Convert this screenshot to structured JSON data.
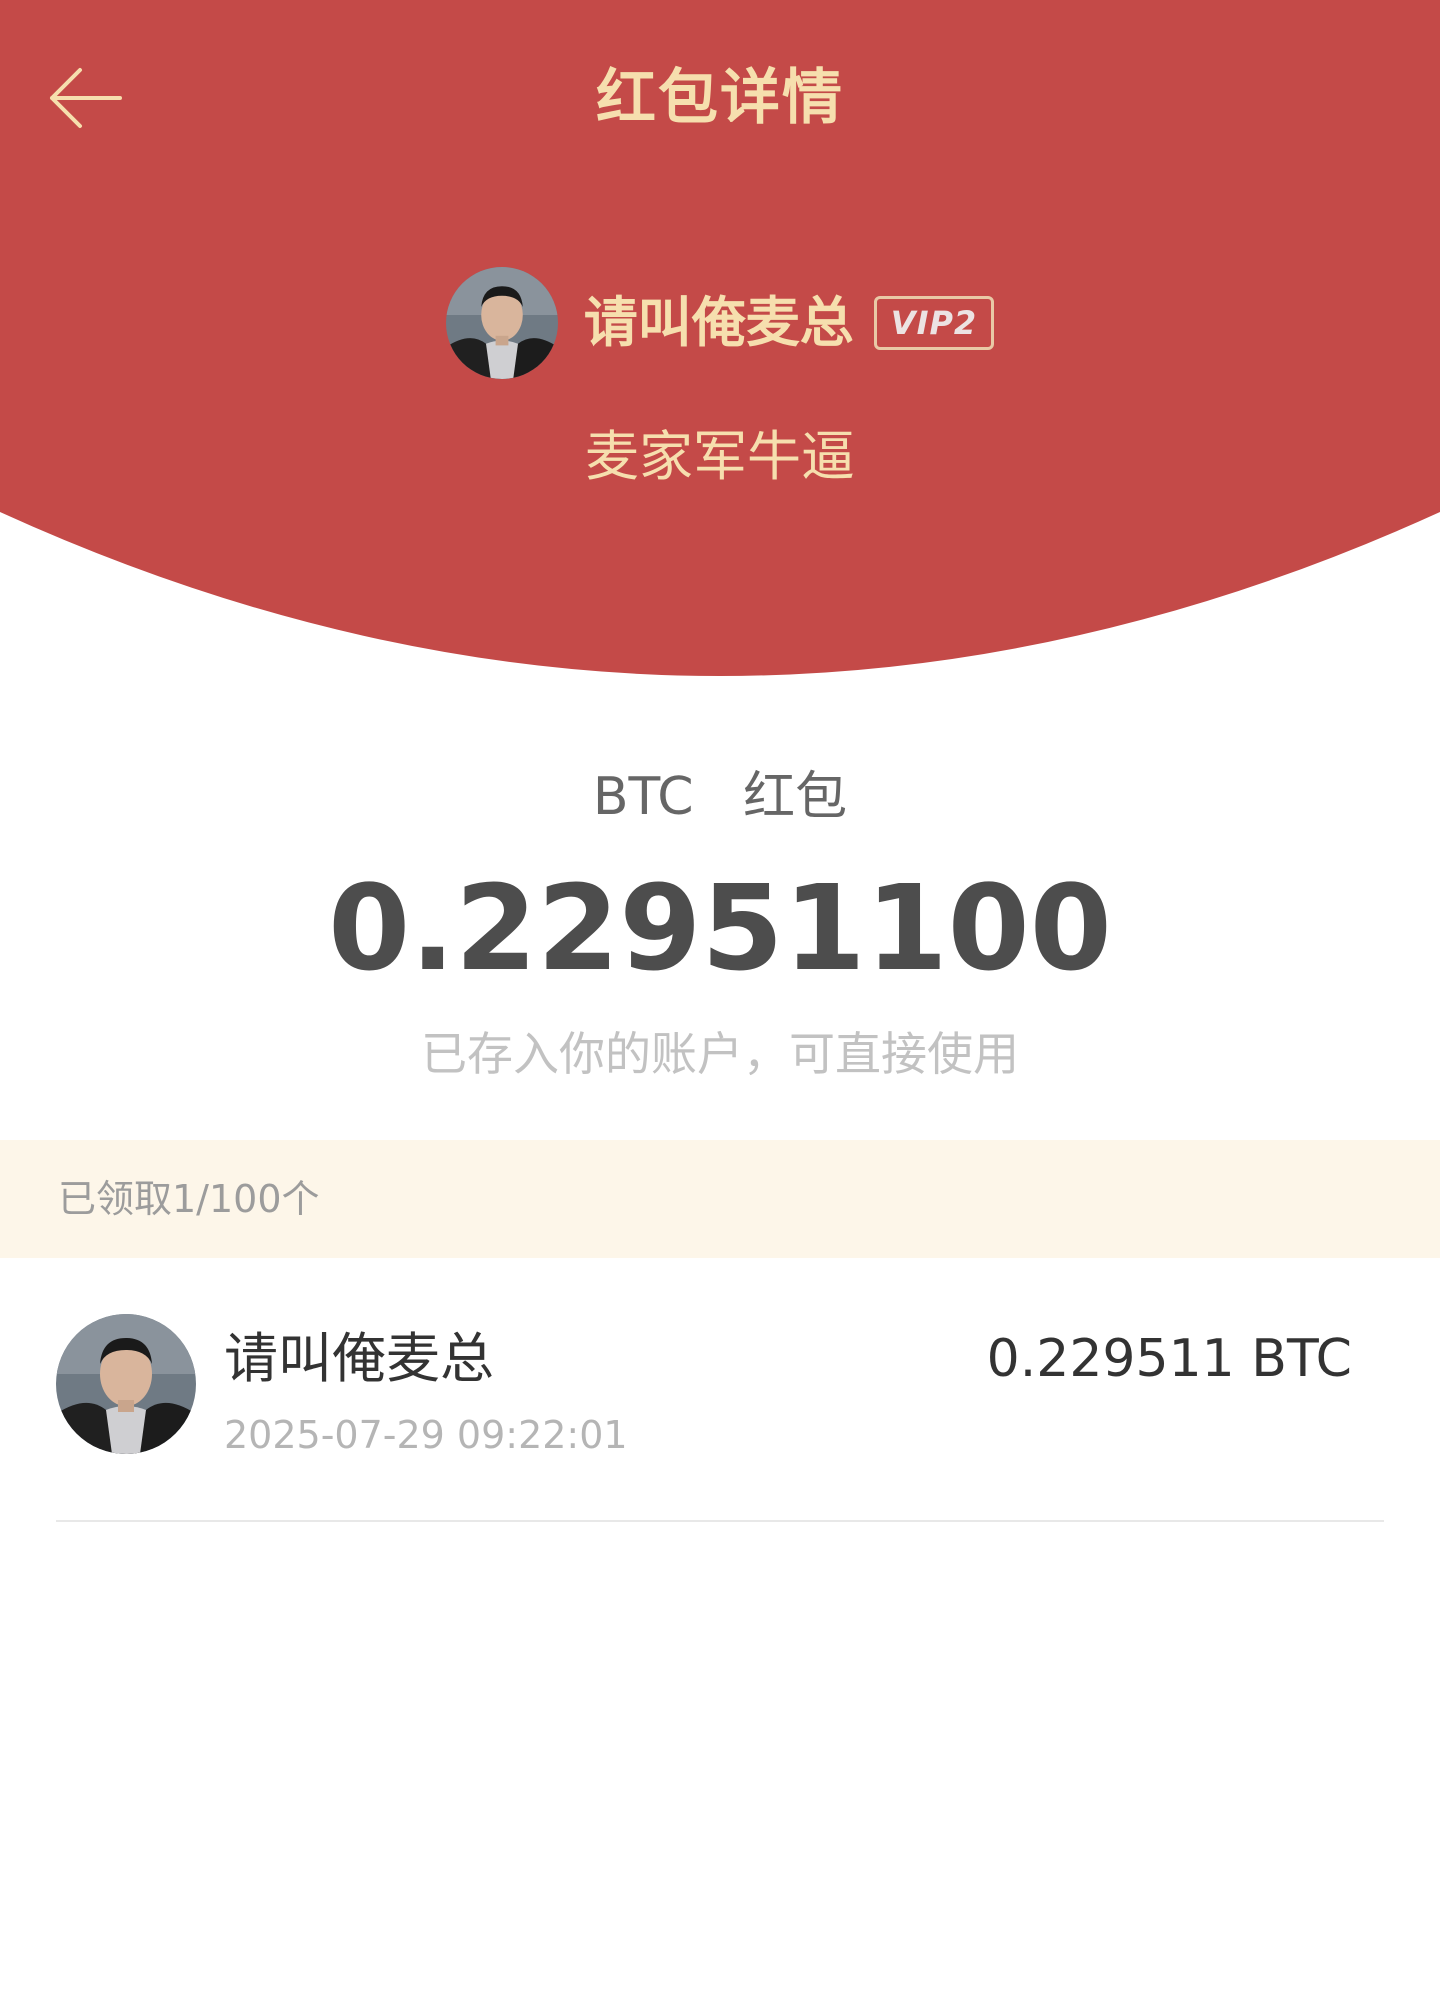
{
  "header": {
    "title": "红包详情",
    "background_color": "#c44a48",
    "text_color": "#f6dfae"
  },
  "sender": {
    "name": "请叫俺麦总",
    "vip_badge": "VIP2",
    "greeting": "麦家军牛逼"
  },
  "packet": {
    "currency": "BTC",
    "type_label": "红包",
    "amount": "0.22951100",
    "deposit_note": "已存入你的账户，可直接使用"
  },
  "claimed_summary": "已领取1/100个",
  "claims": [
    {
      "name": "请叫俺麦总",
      "time": "2025-07-29 09:22:01",
      "amount": "0.229511 BTC"
    }
  ]
}
